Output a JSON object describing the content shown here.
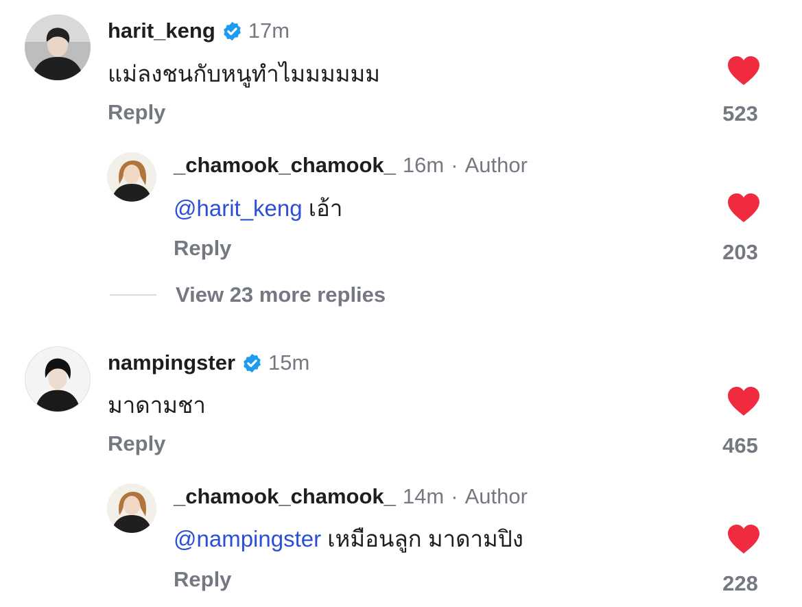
{
  "colors": {
    "mention": "#2b4fd6",
    "secondary_text": "#747881",
    "heart": "#f02a3f",
    "verified": "#1d9bf0"
  },
  "comments": [
    {
      "username": "harit_keng",
      "verified": true,
      "time": "17m",
      "text": "แม่ลงชนกับหนูทำไมมมมมม",
      "reply_label": "Reply",
      "likes": "523",
      "like_icon": "heart-filled-icon"
    },
    {
      "username": "_chamook_chamook_",
      "time": "16m",
      "separator": "·",
      "author_label": "Author",
      "mention": "@harit_keng",
      "text": "เอ้า",
      "reply_label": "Reply",
      "likes": "203",
      "like_icon": "heart-filled-icon"
    },
    {
      "username": "nampingster",
      "verified": true,
      "time": "15m",
      "text": "มาดามชา",
      "reply_label": "Reply",
      "likes": "465",
      "like_icon": "heart-filled-icon"
    },
    {
      "username": "_chamook_chamook_",
      "time": "14m",
      "separator": "·",
      "author_label": "Author",
      "mention": "@nampingster",
      "text": "เหมือนลูก มาดามปิง",
      "reply_label": "Reply",
      "likes": "228",
      "like_icon": "heart-filled-icon"
    }
  ],
  "view_more": {
    "label": "View 23 more replies"
  }
}
